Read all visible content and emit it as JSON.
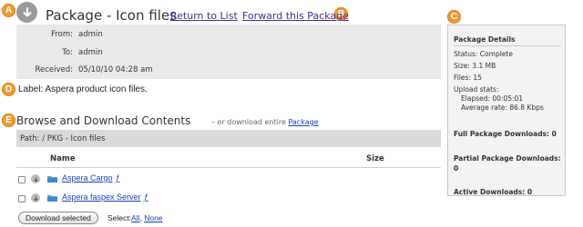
{
  "callouts": {
    "a": "A",
    "b": "B",
    "c": "C",
    "d": "D",
    "e": "E"
  },
  "header": {
    "title": "Package - Icon files",
    "return_link": "Return to List",
    "forward_link": "Forward this Package"
  },
  "meta": {
    "from_key": "From:",
    "from_val": "admin",
    "to_key": "To:",
    "to_val": "admin",
    "received_key": "Received:",
    "received_val": "05/10/10 04:28 am"
  },
  "label_line": "Label: Aspera product icon files.",
  "browse": {
    "title": "Browse and Download Contents",
    "or_text": "– or download entire ",
    "package_link": "Package",
    "path": "Path: / PKG - Icon files",
    "col_name": "Name",
    "col_size": "Size",
    "files": [
      {
        "name": "Aspera Cargo",
        "mark": "ƒ"
      },
      {
        "name": "Aspera faspex Server",
        "mark": "ƒ"
      }
    ]
  },
  "footer": {
    "download_button": "Download selected",
    "select_label": "Select:",
    "select_all": "All",
    "select_comma": ",",
    "select_none": "None"
  },
  "side": {
    "title": "Package Details",
    "status": "Status: Complete",
    "size": "Size: 3.1 MB",
    "files": "Files: 15",
    "upload_stats": "Upload stats:",
    "elapsed": "Elapsed: 00:05:01",
    "avg_rate": "Average rate: 86.8 Kbps",
    "full_downloads": "Full Package Downloads: 0",
    "partial_downloads": "Partial Package Downloads: 0",
    "active_downloads": "Active Downloads: 0"
  },
  "colors": {
    "callout": "#f29a2e",
    "link": "#1a3fb3",
    "link_visited": "#4b2d8f",
    "meta_bg": "#e9e9e9"
  }
}
